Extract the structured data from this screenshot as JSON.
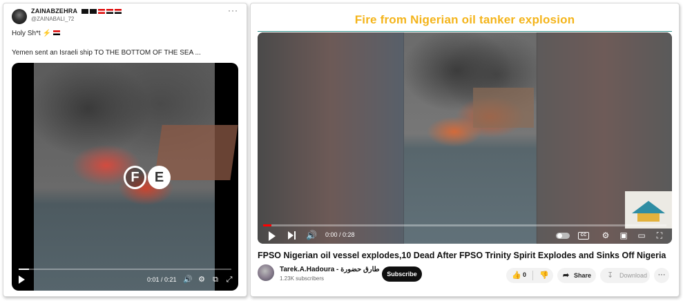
{
  "tweet": {
    "display_name": "ZAINABZEHRA",
    "handle": "@ZAINABALI_72",
    "line1": "Holy Sh*t",
    "line1_emoji": "⚡",
    "line2": "Yemen sent an Israeli ship TO THE BOTTOM OF THE SEA ...",
    "more_icon": "more-horizontal-icon",
    "video": {
      "logo_letters": [
        "F",
        "E"
      ],
      "time": "0:01 / 0:21",
      "progress": 0.05
    }
  },
  "youtube": {
    "overlay_title": "Fire from Nigerian oil tanker explosion",
    "player": {
      "time": "0:00 / 0:28",
      "progress": 0.02,
      "cc_label": "CC"
    },
    "video_title": "FPSO Nigerian oil vessel explodes,10 Dead After FPSO Trinity Spirit Explodes and Sinks Off Nigeria",
    "channel_name": "Tarek.A.Hadoura - طارق حضورة",
    "subscribers": "1.23K subscribers",
    "subscribe_label": "Subscribe",
    "likes": "0",
    "share_label": "Share",
    "download_label": "Download"
  },
  "colors": {
    "overlay_title": "#f4b41a",
    "accent_teal": "#2c8f88",
    "progress_red": "#ff0000"
  }
}
